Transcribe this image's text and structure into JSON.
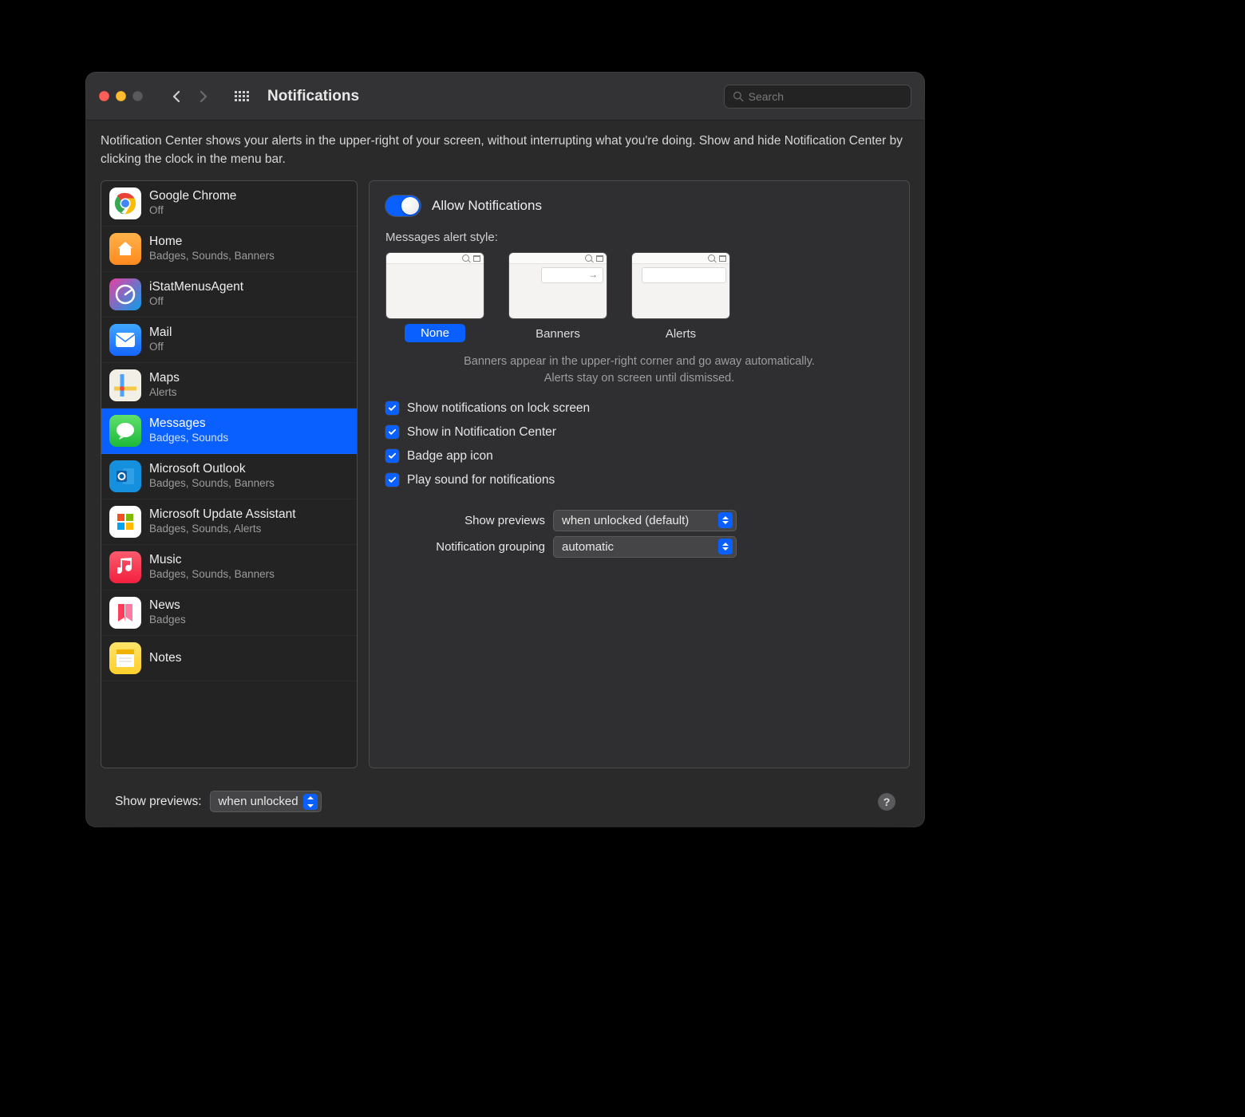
{
  "window": {
    "title": "Notifications",
    "search_placeholder": "Search"
  },
  "intro": "Notification Center shows your alerts in the upper-right of your screen, without interrupting what you're doing. Show and hide Notification Center by clicking the clock in the menu bar.",
  "apps": [
    {
      "name": "Google Chrome",
      "sub": "Off",
      "icon": "chrome"
    },
    {
      "name": "Home",
      "sub": "Badges, Sounds, Banners",
      "icon": "home"
    },
    {
      "name": "iStatMenusAgent",
      "sub": "Off",
      "icon": "istat"
    },
    {
      "name": "Mail",
      "sub": "Off",
      "icon": "mail"
    },
    {
      "name": "Maps",
      "sub": "Alerts",
      "icon": "maps"
    },
    {
      "name": "Messages",
      "sub": "Badges, Sounds",
      "icon": "msg",
      "selected": true
    },
    {
      "name": "Microsoft Outlook",
      "sub": "Badges, Sounds, Banners",
      "icon": "outlook"
    },
    {
      "name": "Microsoft Update Assistant",
      "sub": "Badges, Sounds, Alerts",
      "icon": "mua"
    },
    {
      "name": "Music",
      "sub": "Badges, Sounds, Banners",
      "icon": "music"
    },
    {
      "name": "News",
      "sub": "Badges",
      "icon": "news"
    },
    {
      "name": "Notes",
      "sub": "",
      "icon": "notes"
    }
  ],
  "detail": {
    "allow_label": "Allow Notifications",
    "style_heading": "Messages alert style:",
    "styles": {
      "none": "None",
      "banners": "Banners",
      "alerts": "Alerts",
      "selected": "none"
    },
    "style_desc": "Banners appear in the upper-right corner and go away automatically. Alerts stay on screen until dismissed.",
    "checks": {
      "lock_screen": "Show notifications on lock screen",
      "notif_center": "Show in Notification Center",
      "badge": "Badge app icon",
      "sound": "Play sound for notifications"
    },
    "show_previews_label": "Show previews",
    "show_previews_value": "when unlocked (default)",
    "grouping_label": "Notification grouping",
    "grouping_value": "automatic"
  },
  "footer": {
    "label": "Show previews:",
    "value": "when unlocked"
  }
}
